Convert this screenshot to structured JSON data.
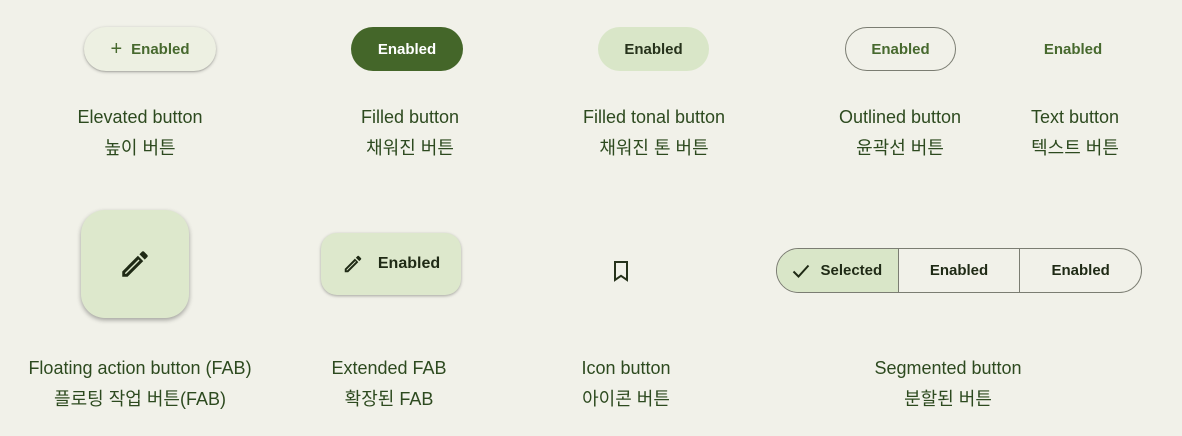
{
  "colors": {
    "background": "#f1f1e9",
    "primary": "#446629",
    "primary_text": "#47692e",
    "tonal_container": "#d9e6c8",
    "fab_container": "#dde8cc",
    "outline": "#7b7d72",
    "label_text": "#2d4a1f"
  },
  "row1": {
    "elevated": {
      "label": "Enabled",
      "icon": "plus-icon",
      "caption_en": "Elevated button",
      "caption_ko": "높이 버튼"
    },
    "filled": {
      "label": "Enabled",
      "caption_en": "Filled button",
      "caption_ko": "채워진 버튼"
    },
    "tonal": {
      "label": "Enabled",
      "caption_en": "Filled tonal button",
      "caption_ko": "채워진 톤 버튼"
    },
    "outlined": {
      "label": "Enabled",
      "caption_en": "Outlined button",
      "caption_ko": "윤곽선 버튼"
    },
    "text": {
      "label": "Enabled",
      "caption_en": "Text button",
      "caption_ko": "텍스트 버튼"
    }
  },
  "row2": {
    "fab": {
      "icon": "pencil-icon",
      "caption_en": "Floating action button (FAB)",
      "caption_ko": "플로팅 작업 버튼(FAB)"
    },
    "extended_fab": {
      "label": "Enabled",
      "icon": "pencil-icon",
      "caption_en": "Extended FAB",
      "caption_ko": "확장된 FAB"
    },
    "icon_button": {
      "icon": "bookmark-icon",
      "caption_en": "Icon button",
      "caption_ko": "아이콘 버튼"
    },
    "segmented": {
      "segments": [
        {
          "label": "Selected",
          "selected": true,
          "icon": "check-icon"
        },
        {
          "label": "Enabled",
          "selected": false
        },
        {
          "label": "Enabled",
          "selected": false
        }
      ],
      "caption_en": "Segmented button",
      "caption_ko": "분할된 버튼"
    }
  }
}
